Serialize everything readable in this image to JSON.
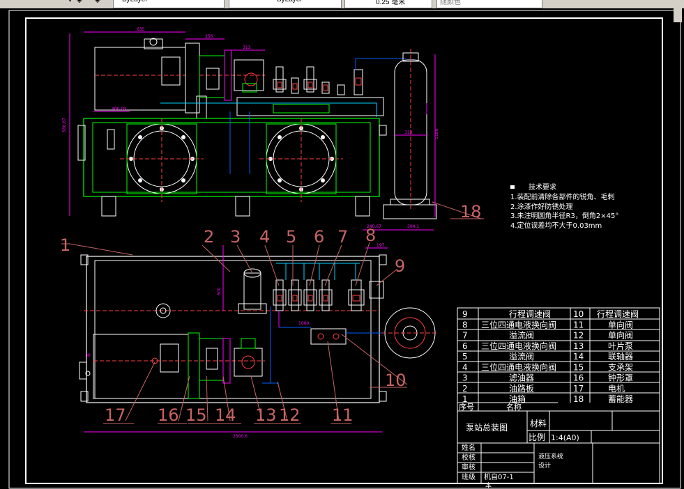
{
  "toolbar": {
    "layer_value": "ByLayer",
    "linetype_value": "ByLayer",
    "lineweight_value": "0.25 毫米",
    "color_value": "随颜色"
  },
  "tech_requirements": {
    "title": "技术要求",
    "items": [
      "1.装配前清除各部件的锐角、毛刺",
      "2.涂漆作好防锈处理",
      "3.未注明圆角半径R3，倒角2×45°",
      "4.定位误差均不大于0.03mm"
    ]
  },
  "balloons": [
    "1",
    "2",
    "3",
    "4",
    "5",
    "6",
    "7",
    "8",
    "9",
    "10",
    "11",
    "12",
    "13",
    "14",
    "15",
    "16",
    "17",
    "18"
  ],
  "dimensions": {
    "d635": "635",
    "d256": "256",
    "d400": "400.09",
    "d313": "313",
    "d1180": "1180",
    "d2500": "2500.6",
    "d240": "240.67",
    "d304": "304.1",
    "d580": "580.87",
    "d500": "500",
    "d1000": "1000",
    "d197": "197",
    "d30": "30"
  },
  "parts_list": {
    "rows": [
      {
        "no": "9",
        "name": "行程调速阀",
        "no2": "10",
        "name2": "行程调速阀"
      },
      {
        "no": "8",
        "name": "三位四通电液换向阀",
        "no2": "11",
        "name2": "单向阀"
      },
      {
        "no": "7",
        "name": "溢流阀",
        "no2": "12",
        "name2": "单向阀"
      },
      {
        "no": "6",
        "name": "三位四通电液换向阀",
        "no2": "13",
        "name2": "叶片泵"
      },
      {
        "no": "5",
        "name": "溢流阀",
        "no2": "14",
        "name2": "联轴器"
      },
      {
        "no": "4",
        "name": "三位四通电液换向阀",
        "no2": "15",
        "name2": "支承架"
      },
      {
        "no": "3",
        "name": "滤油器",
        "no2": "16",
        "name2": "钟形罩"
      },
      {
        "no": "2",
        "name": "油路板",
        "no2": "17",
        "name2": "电机"
      },
      {
        "no": "1",
        "name": "油箱",
        "no2": "18",
        "name2": "蓄能器"
      }
    ],
    "header_no": "序号",
    "header_name": "名称"
  },
  "title_block": {
    "drawing_name": "泵站总装图",
    "material_label": "材料",
    "scale_label": "比例",
    "scale_value": "1:4(A0)",
    "designer_label": "姓名",
    "checker_label": "校核",
    "reviewer_label": "审核",
    "class_label": "班级",
    "class_value": "机自07-1",
    "class_suffix": "本",
    "project_line1": "液压系统",
    "project_line2": "设计"
  },
  "colors": {
    "background": "#000000",
    "frame": "#ffffff",
    "machine": "#00ff00",
    "dim": "#ff00ff",
    "leader": "#ff4040",
    "pipe": "#0060ff",
    "pipe_light": "#00d0ff",
    "valve": "#ffffff",
    "balloon": "#c86464"
  }
}
